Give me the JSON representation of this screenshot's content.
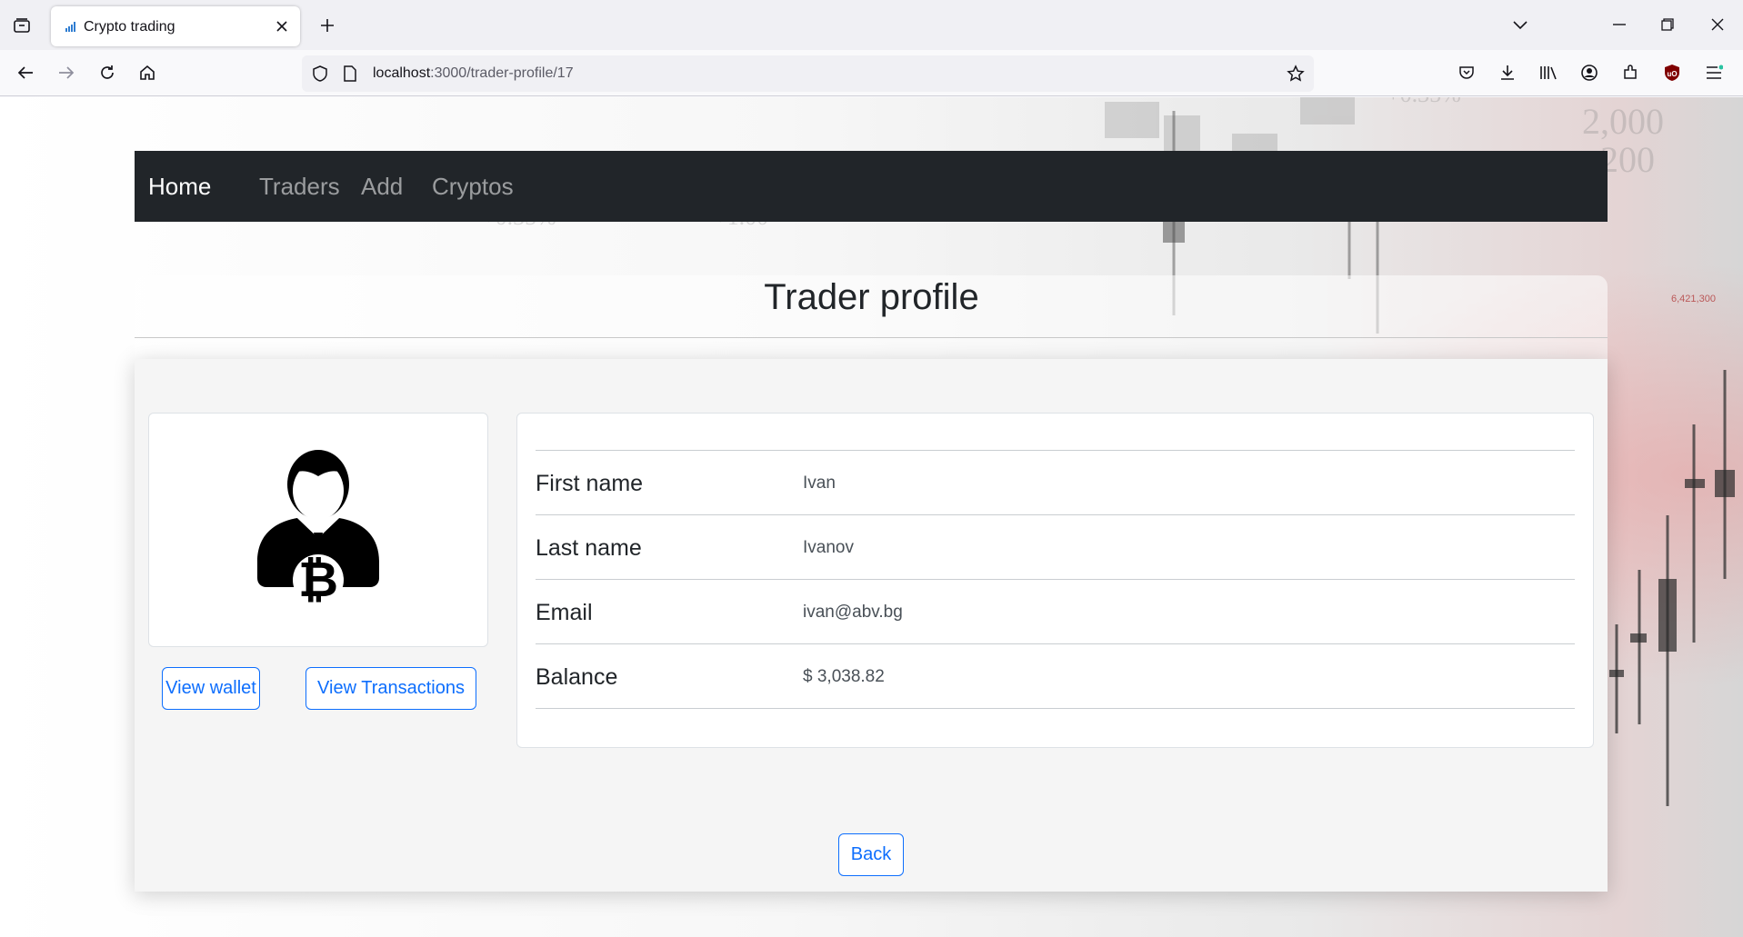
{
  "browser": {
    "tab_title": "Crypto trading",
    "url_host": "localhost",
    "url_path": ":3000/trader-profile/17"
  },
  "nav": {
    "brand": "Home",
    "items": [
      "Traders",
      "Add",
      "Cryptos"
    ]
  },
  "page_title": "Trader profile",
  "profile": {
    "fields": [
      {
        "label": "First name",
        "value": "Ivan"
      },
      {
        "label": "Last name",
        "value": "Ivanov"
      },
      {
        "label": "Email",
        "value": "ivan@abv.bg"
      },
      {
        "label": "Balance",
        "value": "$ 3,038.82"
      }
    ],
    "view_wallet_label": "View wallet",
    "view_transactions_label": "View Transactions",
    "back_label": "Back"
  },
  "colors": {
    "navbar_bg": "#212529",
    "button_primary": "#0d6efd"
  }
}
